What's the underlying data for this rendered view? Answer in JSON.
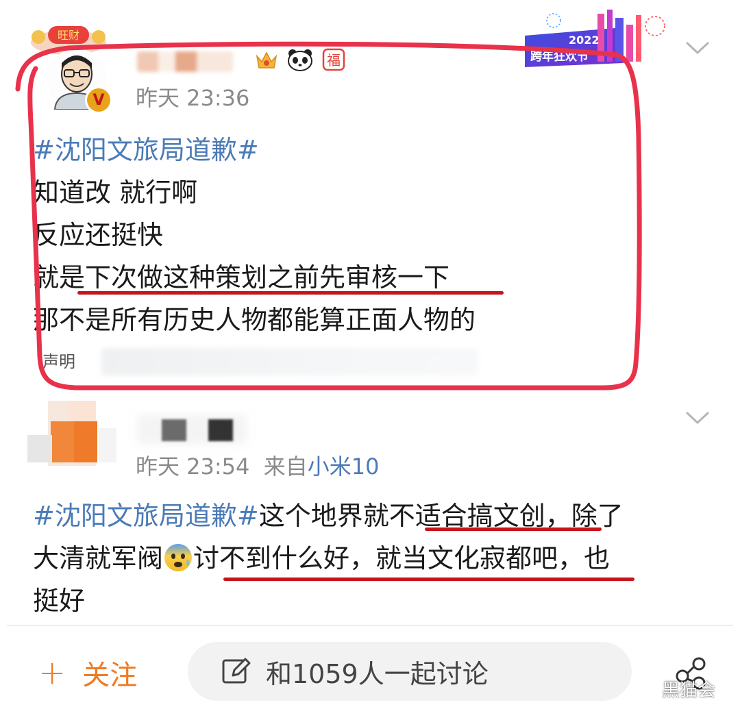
{
  "post1": {
    "time": "昨天 23:36",
    "verified_label": "V",
    "badge_fu": "福",
    "promo_year": "2022",
    "promo_title": "跨年狂欢节",
    "deco_badge_text": "旺财",
    "lines": [
      {
        "hashtag": "#沈阳文旅局道歉#",
        "text": ""
      },
      {
        "hashtag": "",
        "text": "知道改 就行啊"
      },
      {
        "hashtag": "",
        "text": "反应还挺快"
      },
      {
        "hashtag": "",
        "text": "就是下次做这种策划之前先审核一下"
      },
      {
        "hashtag": "",
        "text": "那不是所有历史人物都能算正面人物的"
      }
    ],
    "statement_label": "声明"
  },
  "post2": {
    "time": "昨天 23:54",
    "source_prefix": "来自",
    "device": "小米10",
    "line1_hashtag": "#沈阳文旅局道歉#",
    "line1_text": "这个地界就不适合搞文创，除了",
    "line2_before": "大清就军阀",
    "line2_after": "讨不到什么好，就当文化寂都吧，也",
    "line3": "挺好"
  },
  "bottom_bar": {
    "follow_label": "关注",
    "discuss_label": "和1059人一起讨论"
  },
  "watermark": "黑猫会",
  "colors": {
    "hashtag": "#4b7bb7",
    "accent_orange": "#f07a22",
    "annotation_red": "#e8324b",
    "underline_red": "#c5141c"
  },
  "icons": [
    "verified-icon",
    "vip-crown-icon",
    "panda-icon",
    "fu-badge-icon",
    "chevron-down-icon",
    "fearful-emoji-icon",
    "plus-icon",
    "edit-icon",
    "share-icon",
    "wechat-icon"
  ]
}
